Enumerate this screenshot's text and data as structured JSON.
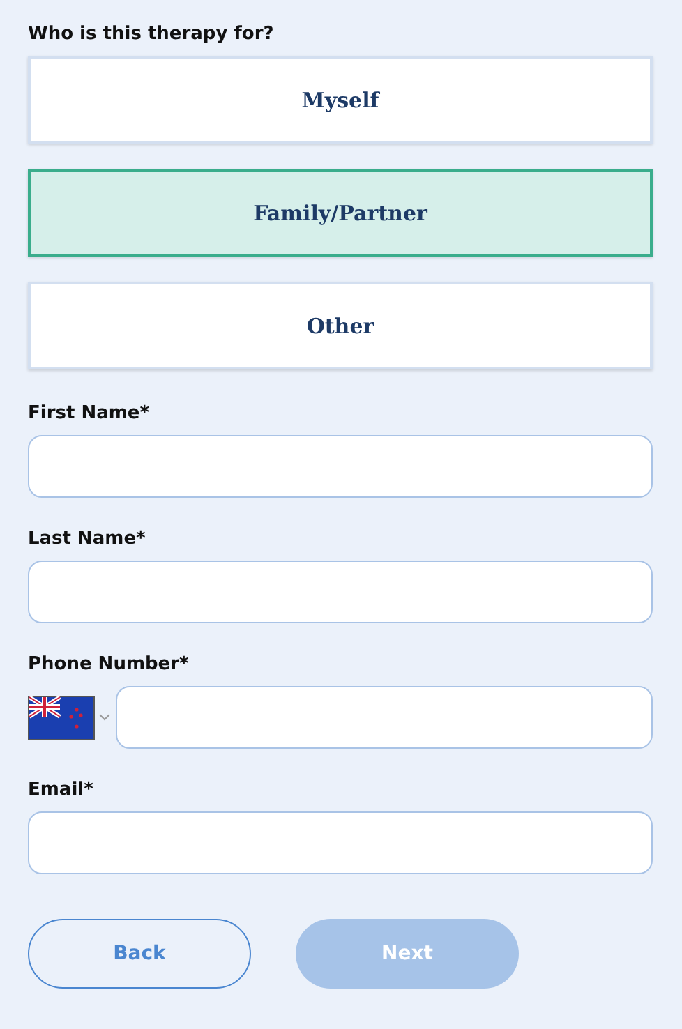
{
  "question": "Who is this therapy for?",
  "options": [
    {
      "label": "Myself",
      "selected": false
    },
    {
      "label": "Family/Partner",
      "selected": true
    },
    {
      "label": "Other",
      "selected": false
    }
  ],
  "fields": [
    {
      "label": "First Name*",
      "kind": "text"
    },
    {
      "label": "Last Name*",
      "kind": "text"
    },
    {
      "label": "Phone Number*",
      "kind": "phone"
    },
    {
      "label": "Email*",
      "kind": "text"
    }
  ],
  "buttons": [
    {
      "label": "Back",
      "disabled": false,
      "kind": "outline"
    },
    {
      "label": "Next",
      "disabled": true,
      "kind": "primary"
    }
  ]
}
